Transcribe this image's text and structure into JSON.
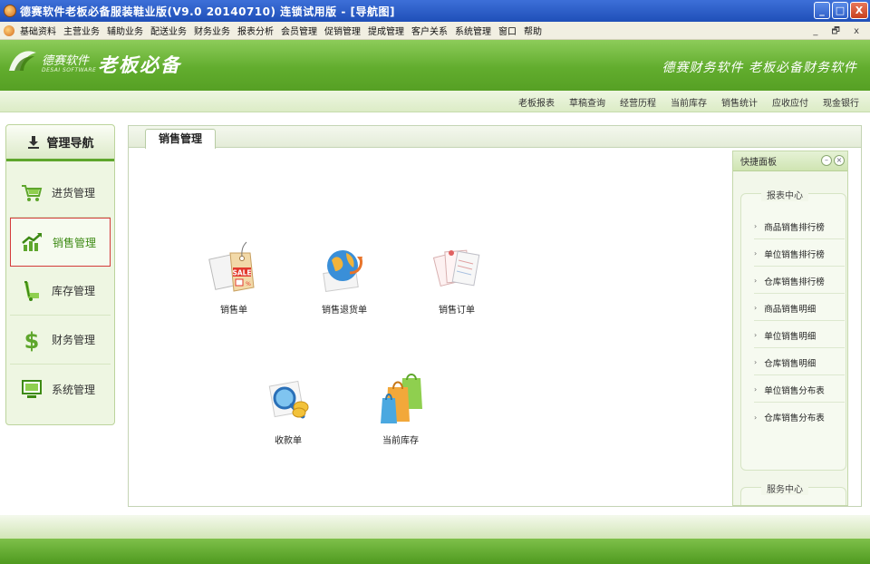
{
  "window": {
    "title": "德赛软件老板必备服装鞋业版(V9.0 20140710) 连锁试用版 - [导航图]",
    "controls": [
      "_",
      "□",
      "X"
    ]
  },
  "menubar": {
    "items": [
      "基础资料",
      "主营业务",
      "辅助业务",
      "配送业务",
      "财务业务",
      "报表分析",
      "会员管理",
      "促销管理",
      "提成管理",
      "客户关系",
      "系统管理",
      "窗口",
      "帮助"
    ],
    "right_controls": "_ 🗗 x"
  },
  "banner": {
    "logo_cn": "德赛软件",
    "logo_en": "DESAI SOFTWARE",
    "product": "老板必备",
    "slogan": "德赛财务软件 老板必备财务软件"
  },
  "quicklinks": [
    "老板报表",
    "草稿查询",
    "经营历程",
    "当前库存",
    "销售统计",
    "应收应付",
    "现金银行"
  ],
  "nav": {
    "title": "管理导航",
    "items": [
      {
        "label": "进货管理",
        "icon": "cart-icon"
      },
      {
        "label": "销售管理",
        "icon": "chart-up-icon"
      },
      {
        "label": "库存管理",
        "icon": "truck-icon"
      },
      {
        "label": "财务管理",
        "icon": "dollar-icon"
      },
      {
        "label": "系统管理",
        "icon": "monitor-icon"
      }
    ],
    "active_index": 1
  },
  "main": {
    "tab": "销售管理",
    "modules": [
      {
        "label": "销售单",
        "icon": "sale-tag-icon"
      },
      {
        "label": "销售退货单",
        "icon": "globe-return-icon"
      },
      {
        "label": "销售订单",
        "icon": "order-docs-icon"
      },
      {
        "label": "收款单",
        "icon": "magnifier-coin-icon"
      },
      {
        "label": "当前库存",
        "icon": "shopping-bags-icon"
      }
    ]
  },
  "quickpanel": {
    "title": "快捷面板",
    "report_center": {
      "title": "报表中心",
      "links": [
        "商品销售排行榜",
        "单位销售排行榜",
        "仓库销售排行榜",
        "商品销售明细",
        "单位销售明细",
        "仓库销售明细",
        "单位销售分布表",
        "仓库销售分布表"
      ]
    },
    "service_center": {
      "title": "服务中心"
    }
  },
  "colors": {
    "accent_green": "#62ad2e",
    "title_blue": "#1f4fb8",
    "active_border": "#d43a3a"
  }
}
